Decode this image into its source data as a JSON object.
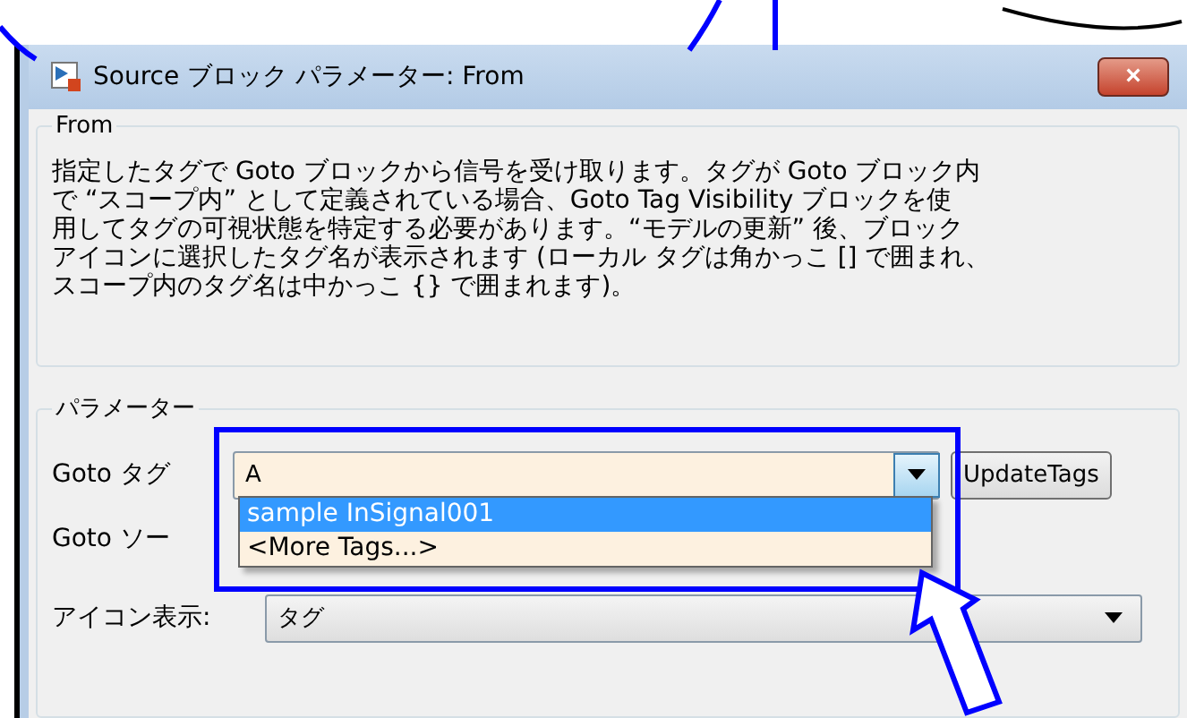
{
  "window": {
    "title": "Source ブロック パラメーター: From",
    "close": "×"
  },
  "description_group": {
    "legend": "From",
    "lines": [
      "指定したタグで Goto ブロックから信号を受け取ります。タグが Goto ブロック内",
      "で “スコープ内” として定義されている場合、Goto Tag Visibility ブロックを使",
      "用してタグの可視状態を特定する必要があります。“モデルの更新” 後、ブロック",
      "アイコンに選択したタグ名が表示されます (ローカル タグは角かっこ [] で囲まれ、",
      "スコープ内のタグ名は中かっこ {} で囲まれます)。"
    ]
  },
  "parameters": {
    "legend": "パラメーター",
    "goto_tag": {
      "label": "Goto タグ",
      "value": "A",
      "expanded": true,
      "options": [
        {
          "label": "sample InSignal001",
          "selected": true
        },
        {
          "label": "<More Tags...>",
          "selected": false
        }
      ],
      "button": "UpdateTags"
    },
    "goto_source": {
      "label": "Goto ソー"
    },
    "icon_display": {
      "label": "アイコン表示:",
      "value": "タグ"
    }
  }
}
